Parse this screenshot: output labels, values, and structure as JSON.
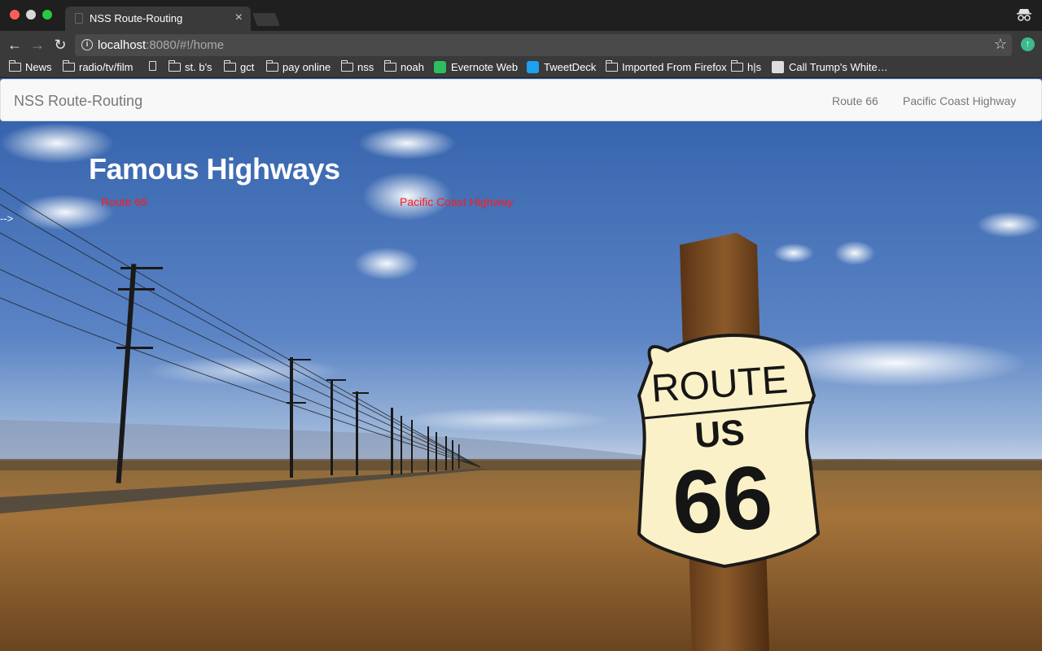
{
  "browser": {
    "tab_title": "NSS Route-Routing",
    "url_host": "localhost",
    "url_rest": ":8080/#!/home",
    "bookmarks": [
      {
        "label": "News",
        "icon": "folder-icon"
      },
      {
        "label": "radio/tv/film",
        "icon": "folder-icon"
      },
      {
        "label": "",
        "icon": "page-icon"
      },
      {
        "label": "st. b's",
        "icon": "folder-icon"
      },
      {
        "label": "gct",
        "icon": "folder-icon"
      },
      {
        "label": "pay online",
        "icon": "folder-icon"
      },
      {
        "label": "nss",
        "icon": "folder-icon"
      },
      {
        "label": "noah",
        "icon": "folder-icon"
      },
      {
        "label": "Evernote Web",
        "icon": "evernote-icon"
      },
      {
        "label": "TweetDeck",
        "icon": "tweetdeck-icon"
      },
      {
        "label": "Imported From Firefox",
        "icon": "folder-icon"
      },
      {
        "label": "h|s",
        "icon": "folder-icon"
      },
      {
        "label": "Call Trump's White…",
        "icon": "white-house-icon"
      }
    ]
  },
  "page": {
    "navbar": {
      "brand": "NSS Route-Routing",
      "links": [
        "Route 66",
        "Pacific Coast Highway"
      ]
    },
    "hero": {
      "title": "Famous Highways",
      "links": [
        "Route 66",
        "Pacific Coast Highway"
      ],
      "stray_text": "-->"
    },
    "sign": {
      "line1": "ROUTE",
      "line2": "US",
      "line3": "66"
    }
  },
  "colors": {
    "hero_link": "#ff1a1a",
    "navbar_bg": "#f8f8f8",
    "sky": "#5a7fc0",
    "field": "#9a6a2c"
  }
}
